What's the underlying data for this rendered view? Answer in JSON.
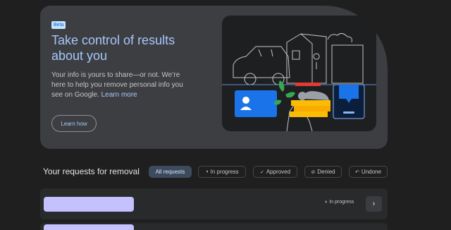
{
  "hero": {
    "badge": "Beta",
    "title": "Take control of results about you",
    "description": "Your info is yours to share—or not. We’re here to help you remove personal info you see on Google.",
    "learn_more": "Learn more",
    "learn_how": "Learn how"
  },
  "requests": {
    "title": "Your requests for removal",
    "filters": [
      {
        "label": "All requests",
        "icon": "",
        "active": true
      },
      {
        "label": "In progress",
        "icon": "in-progress-icon",
        "active": false
      },
      {
        "label": "Approved",
        "icon": "check-icon",
        "active": false
      },
      {
        "label": "Denied",
        "icon": "denied-icon",
        "active": false
      },
      {
        "label": "Undone",
        "icon": "undo-icon",
        "active": false
      }
    ],
    "rows": [
      {
        "status": "In progress"
      }
    ]
  },
  "colors": {
    "accent": "#a8c7fa",
    "background": "#1f1f1f",
    "card": "#3c3e42",
    "redaction": "#c5c1ff"
  }
}
